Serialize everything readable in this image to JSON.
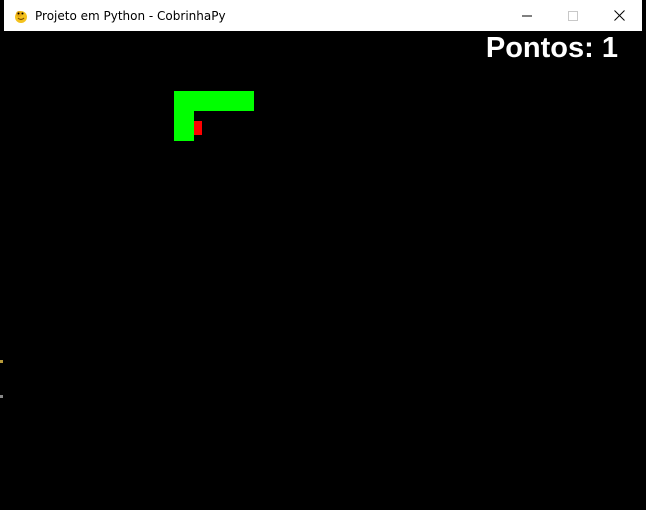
{
  "window": {
    "title": "Projeto em Python - CobrinhaPy",
    "icon": "pygame-snake-icon",
    "controls": [
      "minimize-icon",
      "maximize-icon",
      "close-icon"
    ]
  },
  "game": {
    "score_text": "Pontos: 1",
    "score_color": "#ffffff",
    "background_color": "#000000",
    "snake_color": "#00ff00",
    "food_color": "#ff0000"
  }
}
